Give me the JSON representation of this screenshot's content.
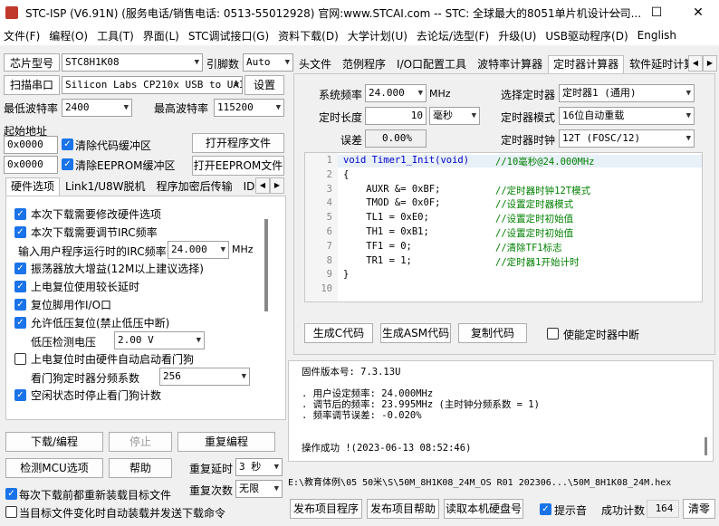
{
  "window": {
    "title": "STC-ISP (V6.91N) (服务电话/销售电话: 0513-55012928) 官网:www.STCAI.com  -- STC: 全球最大的8051单片机设计公司...",
    "minimize": "—",
    "maximize": "☐",
    "close": "✕"
  },
  "menu": [
    "文件(F)",
    "编程(O)",
    "工具(T)",
    "界面(L)",
    "STC调试接口(G)",
    "资料下载(D)",
    "大学计划(U)",
    "去论坛/选型(F)",
    "升级(U)",
    "USB驱动程序(D)",
    "English"
  ],
  "left": {
    "chip_label": "芯片型号",
    "chip_value": "STC8H1K08",
    "pins_label": "引脚数",
    "pins_value": "Auto",
    "scan_label": "扫描串口",
    "port_value": "Silicon Labs CP210x USB to UAI",
    "settings_label": "设置",
    "min_baud_label": "最低波特率",
    "min_baud_value": "2400",
    "max_baud_label": "最高波特率",
    "max_baud_value": "115200",
    "start_addr_label": "起始地址",
    "addr1": "0x0000",
    "clear_code": "清除代码缓冲区",
    "open_prog": "打开程序文件",
    "addr2": "0x0000",
    "clear_eeprom": "清除EEPROM缓冲区",
    "open_eeprom": "打开EEPROM文件",
    "tabs": [
      "硬件选项",
      "Link1/U8W脱机",
      "程序加密后传输",
      "ID号"
    ],
    "hw_options": {
      "opt1": "本次下载需要修改硬件选项",
      "opt2": "本次下载需要调节IRC频率",
      "irc_label": "输入用户程序运行时的IRC频率",
      "irc_value": "24.000",
      "irc_unit": "MHz",
      "opt3": "振荡器放大增益(12M以上建议选择)",
      "opt4": "上电复位使用较长延时",
      "opt5": "复位脚用作I/O口",
      "opt6": "允许低压复位(禁止低压中断)",
      "lv_label": "低压检测电压",
      "lv_value": "2.00 V",
      "opt7": "上电复位时由硬件自动启动看门狗",
      "wdt_label": "看门狗定时器分频系数",
      "wdt_value": "256",
      "opt8": "空闲状态时停止看门狗计数"
    },
    "download_btn": "下载/编程",
    "stop_btn": "停止",
    "reprogram_btn": "重复编程",
    "detect_btn": "检测MCU选项",
    "help_btn": "帮助",
    "repeat_delay_label": "重复延时",
    "repeat_delay_value": "3 秒",
    "repeat_count_label": "重复次数",
    "repeat_count_value": "无限",
    "reload_each": "每次下载前都重新装载目标文件",
    "auto_send": "当目标文件变化时自动装载并发送下载命令"
  },
  "right": {
    "tabs": [
      "头文件",
      "范例程序",
      "I/O口配置工具",
      "波特率计算器",
      "定时器计算器",
      "软件延时计算"
    ],
    "sys_freq_label": "系统频率",
    "sys_freq_value": "24.000",
    "sys_freq_unit": "MHz",
    "timer_sel_label": "选择定时器",
    "timer_sel_value": "定时器1 (通用)",
    "timer_len_label": "定时长度",
    "timer_len_value": "10",
    "timer_len_unit": "毫秒",
    "timer_mode_label": "定时器模式",
    "timer_mode_value": "16位自动重载",
    "error_label": "误差",
    "error_value": "0.00%",
    "timer_clk_label": "定时器时钟",
    "timer_clk_value": "12T (FOSC/12)",
    "code_lines": [
      {
        "n": "1",
        "code": "void Timer1_Init(void)",
        "comment": "//10毫秒@24.000MHz"
      },
      {
        "n": "2",
        "code": "{",
        "comment": ""
      },
      {
        "n": "3",
        "code": "    AUXR &= 0xBF;",
        "comment": "//定时器时钟12T模式"
      },
      {
        "n": "4",
        "code": "    TMOD &= 0x0F;",
        "comment": "//设置定时器模式"
      },
      {
        "n": "5",
        "code": "    TL1 = 0xE0;",
        "comment": "//设置定时初始值"
      },
      {
        "n": "6",
        "code": "    TH1 = 0xB1;",
        "comment": "//设置定时初始值"
      },
      {
        "n": "7",
        "code": "    TF1 = 0;",
        "comment": "//清除TF1标志"
      },
      {
        "n": "8",
        "code": "    TR1 = 1;",
        "comment": "//定时器1开始计时"
      },
      {
        "n": "9",
        "code": "}",
        "comment": ""
      },
      {
        "n": "10",
        "code": "",
        "comment": ""
      }
    ],
    "gen_c": "生成C代码",
    "gen_asm": "生成ASM代码",
    "copy_code": "复制代码",
    "enable_int": "使能定时器中断",
    "log_lines": [
      "固件版本号: 7.3.13U",
      "",
      ". 用户设定频率: 24.000MHz",
      ". 调节后的频率: 23.995MHz (主时钟分频系数 = 1)",
      ". 频率调节误差: -0.020%",
      "",
      "",
      "操作成功 !(2023-06-13 08:52:46)"
    ],
    "file_path": "E:\\教育体例\\05 50米\\S\\50M_8H1K08_24M_OS R01 202306...\\50M_8H1K08_24M.hex",
    "publish_prog": "发布项目程序",
    "publish_help": "发布项目帮助",
    "read_disk": "读取本机硬盘号",
    "beep": "提示音",
    "success_label": "成功计数",
    "success_value": "164",
    "clear_btn": "清零"
  }
}
